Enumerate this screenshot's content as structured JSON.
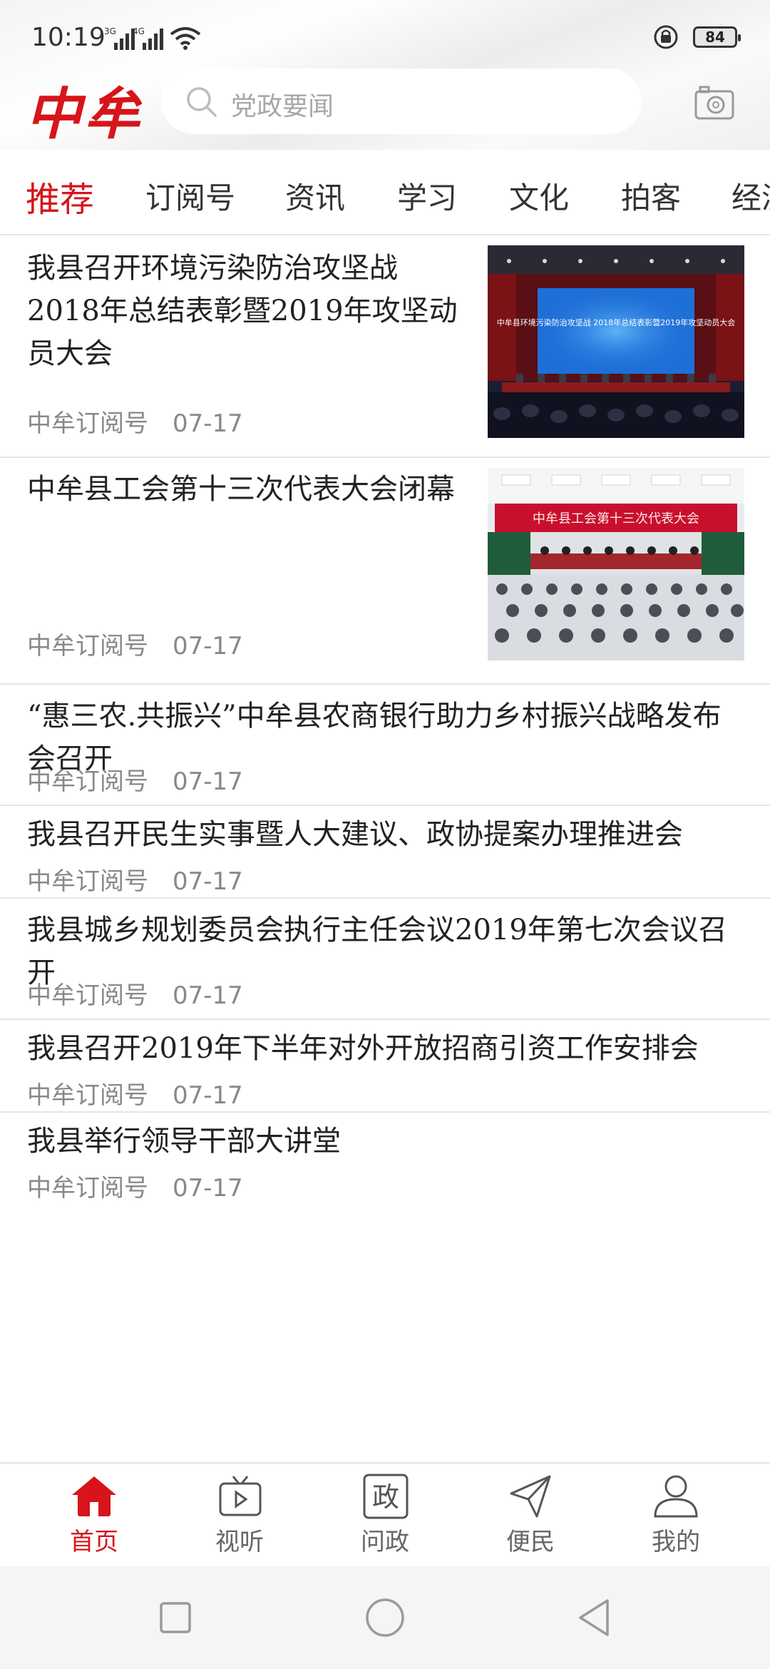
{
  "status_bar": {
    "time": "10:19",
    "network_1": "3G",
    "network_2": "4G",
    "battery": "84"
  },
  "app": {
    "logo": "中牟"
  },
  "search": {
    "placeholder": "党政要闻"
  },
  "tabs": [
    {
      "label": "推荐",
      "active": true
    },
    {
      "label": "订阅号"
    },
    {
      "label": "资讯"
    },
    {
      "label": "学习"
    },
    {
      "label": "文化"
    },
    {
      "label": "拍客"
    },
    {
      "label": "经济"
    }
  ],
  "feed": [
    {
      "title": "我县召开环境污染防治攻坚战2018年总结表彰暨2019年攻坚动员大会",
      "source": "中牟订阅号",
      "date": "07-17",
      "has_image": true,
      "image_banner": "中牟县环境污染防治攻坚战 2018年总结表彰暨2019年攻坚动员大会"
    },
    {
      "title": "中牟县工会第十三次代表大会闭幕",
      "source": "中牟订阅号",
      "date": "07-17",
      "has_image": true,
      "image_banner": "中牟县工会第十三次代表大会"
    },
    {
      "title": "“惠三农.共振兴”中牟县农商银行助力乡村振兴战略发布会召开",
      "source": "中牟订阅号",
      "date": "07-17"
    },
    {
      "title": "我县召开民生实事暨人大建议、政协提案办理推进会",
      "source": "中牟订阅号",
      "date": "07-17"
    },
    {
      "title": "我县城乡规划委员会执行主任会议2019年第七次会议召开",
      "source": "中牟订阅号",
      "date": "07-17"
    },
    {
      "title": "我县召开2019年下半年对外开放招商引资工作安排会",
      "source": "中牟订阅号",
      "date": "07-17"
    },
    {
      "title": "我县举行领导干部大讲堂",
      "source": "中牟订阅号",
      "date": "07-17"
    }
  ],
  "bottom_nav": [
    {
      "label": "首页",
      "icon": "home-icon",
      "active": true
    },
    {
      "label": "视听",
      "icon": "tv-icon"
    },
    {
      "label": "问政",
      "icon": "zheng-icon",
      "glyph": "政"
    },
    {
      "label": "便民",
      "icon": "send-icon"
    },
    {
      "label": "我的",
      "icon": "user-icon"
    }
  ],
  "colors": {
    "accent": "#d7141a",
    "text": "#222222",
    "meta": "#888888",
    "divider": "#e6e6e6"
  }
}
